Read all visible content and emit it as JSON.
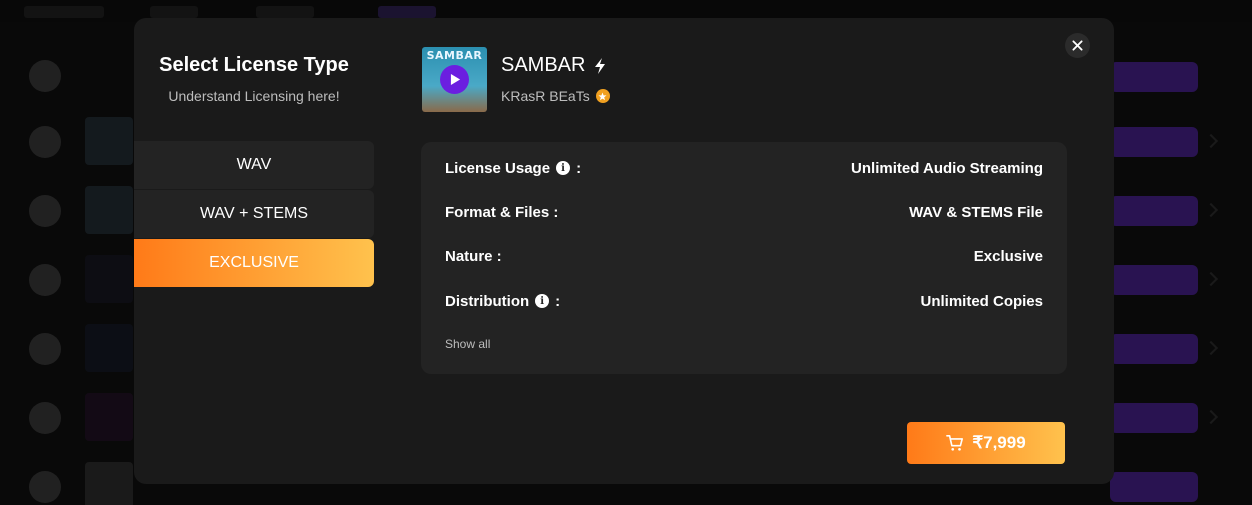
{
  "modal": {
    "title": "Select License Type",
    "subtitle": "Understand Licensing here!",
    "licenses": [
      {
        "label": "WAV",
        "active": false
      },
      {
        "label": "WAV + STEMS",
        "active": false
      },
      {
        "label": "EXCLUSIVE",
        "active": true
      }
    ],
    "track": {
      "cover_text": "SAMBAR",
      "title": "SAMBAR",
      "artist": "KRasR BEaTs"
    },
    "details": [
      {
        "key": "License Usage",
        "info": true,
        "value": "Unlimited Audio Streaming"
      },
      {
        "key": "Format & Files :",
        "info": false,
        "value": "WAV & STEMS File"
      },
      {
        "key": "Nature :",
        "info": false,
        "value": "Exclusive"
      },
      {
        "key": "Distribution",
        "info": true,
        "value": "Unlimited Copies"
      }
    ],
    "colon": ":",
    "show_all": "Show all",
    "price": "₹7,999"
  },
  "colors": {
    "accent_start": "#ff7a18",
    "accent_end": "#ffc24d",
    "play": "#6b1fe0",
    "background_pill": "#5b2bb3"
  },
  "icons": [
    "close-icon",
    "play-icon",
    "bolt-icon",
    "star-badge-icon",
    "info-icon",
    "cart-icon"
  ]
}
